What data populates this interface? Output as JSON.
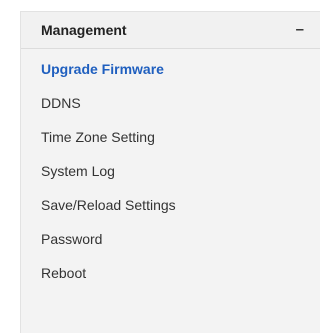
{
  "section": {
    "title": "Management",
    "toggle_symbol": "–",
    "expanded": true
  },
  "menu": {
    "items": [
      {
        "label": "Upgrade Firmware",
        "active": true
      },
      {
        "label": "DDNS",
        "active": false
      },
      {
        "label": "Time Zone Setting",
        "active": false
      },
      {
        "label": "System Log",
        "active": false
      },
      {
        "label": "Save/Reload Settings",
        "active": false
      },
      {
        "label": "Password",
        "active": false
      },
      {
        "label": "Reboot",
        "active": false
      }
    ]
  },
  "colors": {
    "active_item": "#1f5fbf",
    "item_text": "#333333",
    "panel_background": "#f3f3f3"
  }
}
